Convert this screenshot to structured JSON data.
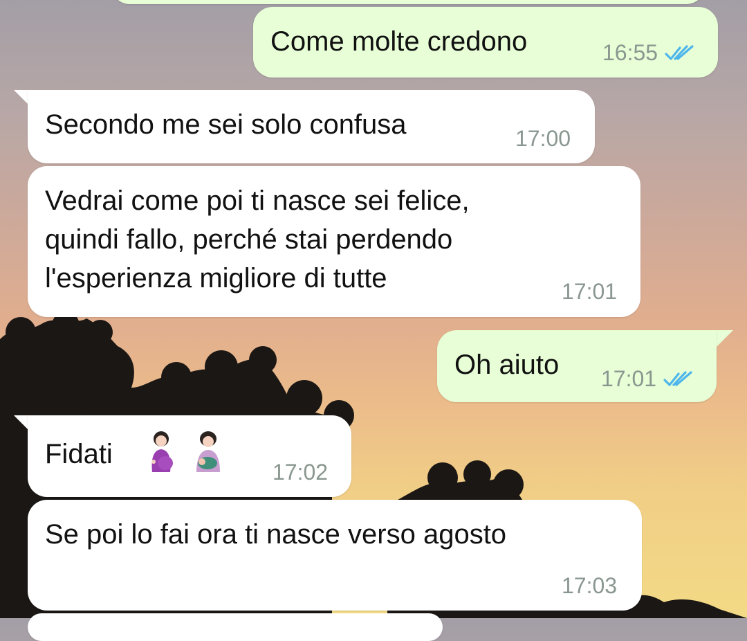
{
  "messages": [
    {
      "direction": "outgoing",
      "text": "",
      "time": ""
    },
    {
      "direction": "outgoing",
      "text": "Come molte credono",
      "time": "16:55",
      "status": "read"
    },
    {
      "direction": "incoming",
      "text": "Secondo me sei solo confusa",
      "time": "17:00"
    },
    {
      "direction": "incoming",
      "lines": [
        "Vedrai come poi ti nasce sei felice,",
        "quindi fallo, perché stai perdendo",
        "l'esperienza migliore di tutte"
      ],
      "time": "17:01"
    },
    {
      "direction": "outgoing",
      "text": "Oh aiuto",
      "time": "17:01",
      "status": "read"
    },
    {
      "direction": "incoming",
      "text": "Fidati",
      "emojis": [
        "pregnant-woman-emoji",
        "breastfeeding-emoji"
      ],
      "time": "17:02"
    },
    {
      "direction": "incoming",
      "text": "Se poi lo fai ora ti nasce verso agosto",
      "time": "17:03"
    }
  ],
  "colors": {
    "incoming_bubble": "#ffffff",
    "outgoing_bubble": "#e7fed6",
    "read_tick": "#4fb6ec",
    "timestamp": "#8a9790"
  },
  "icons": {
    "read_receipt": "double-check-icon"
  }
}
